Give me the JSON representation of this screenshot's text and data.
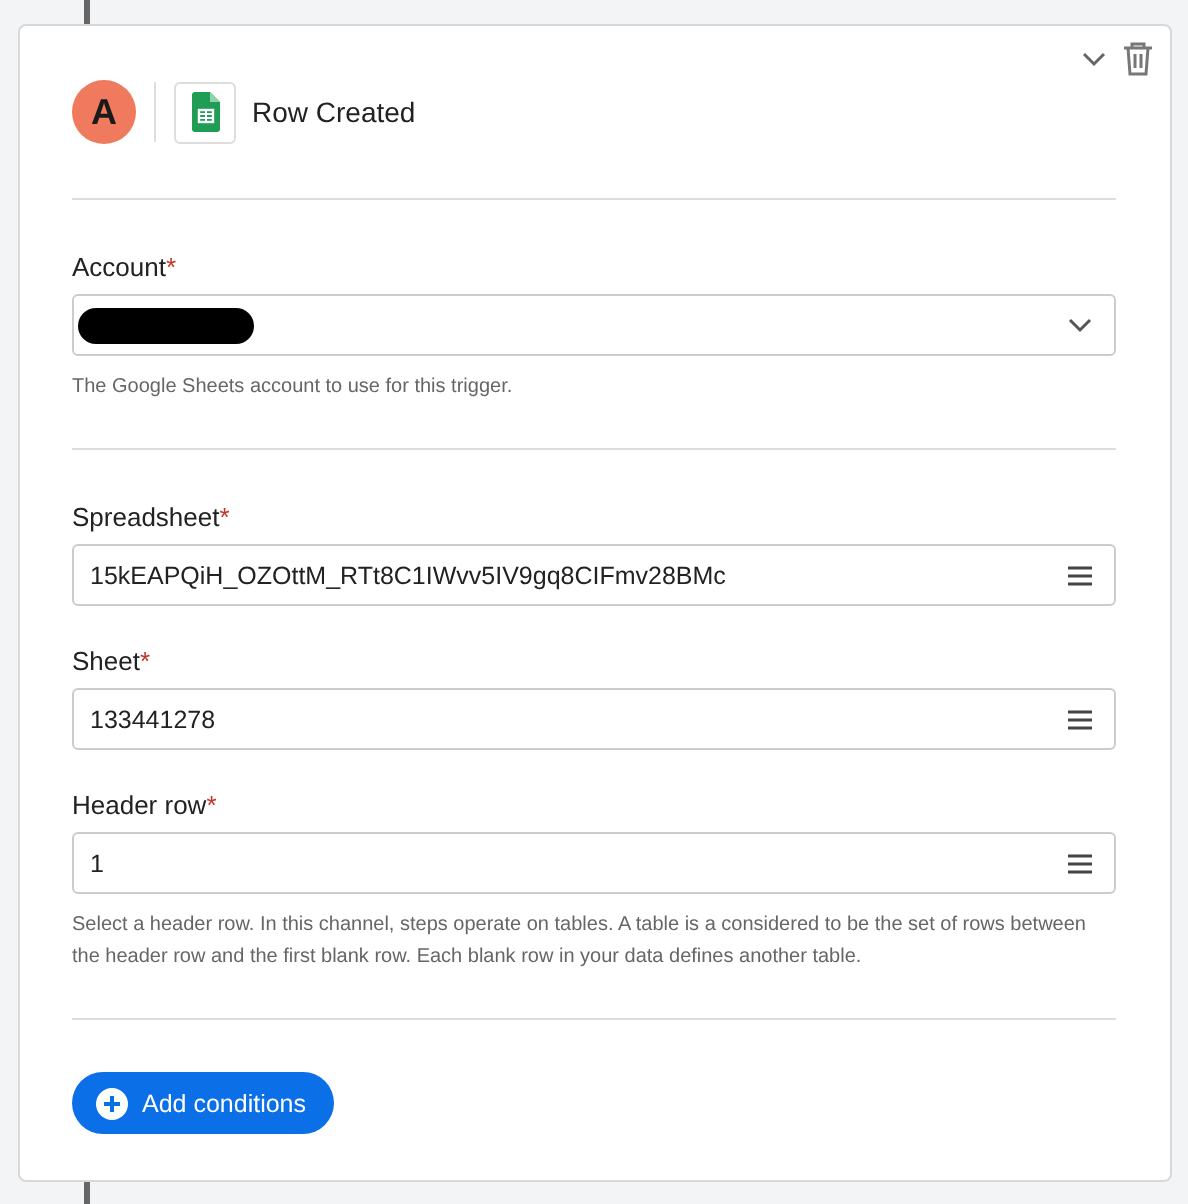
{
  "header": {
    "avatar": "A",
    "title": "Row Created"
  },
  "sections": [
    {
      "fields": [
        {
          "label": "Account",
          "required": true,
          "required_mark": "*",
          "kind": "select",
          "redacted": true,
          "hint": "The Google Sheets account to use for this trigger."
        }
      ]
    },
    {
      "fields": [
        {
          "label": "Spreadsheet",
          "required": true,
          "required_mark": "*",
          "kind": "lookup",
          "value": "15kEAPQiH_OZOttM_RTt8C1IWvv5IV9gq8CIFmv28BMc"
        },
        {
          "label": "Sheet",
          "required": true,
          "required_mark": "*",
          "kind": "lookup",
          "value": "133441278"
        },
        {
          "label": "Header row",
          "required": true,
          "required_mark": "*",
          "kind": "lookup",
          "value": "1",
          "hint": "Select a header row. In this channel, steps operate on tables. A table is a considered to be the set of rows between the header row and the first blank row. Each blank row in your data defines another table."
        }
      ]
    }
  ],
  "button": "Add conditions"
}
